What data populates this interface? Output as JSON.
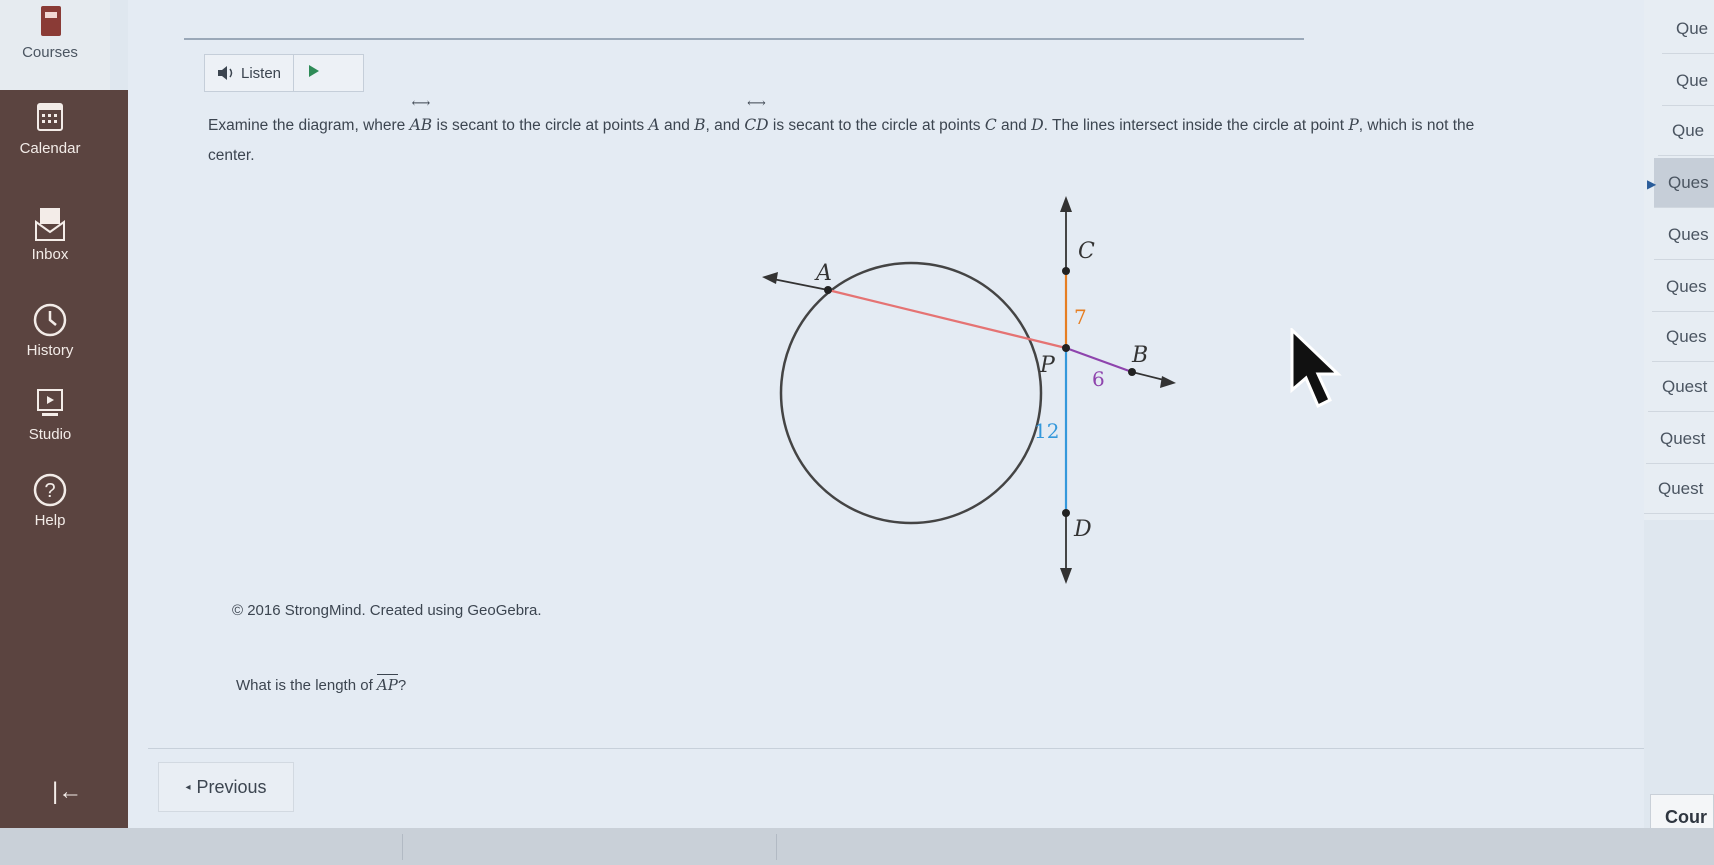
{
  "nav": {
    "items": [
      {
        "label": "Courses",
        "icon": "courses-icon"
      },
      {
        "label": "Calendar",
        "icon": "calendar-icon"
      },
      {
        "label": "Inbox",
        "icon": "inbox-icon"
      },
      {
        "label": "History",
        "icon": "history-icon"
      },
      {
        "label": "Studio",
        "icon": "studio-icon"
      },
      {
        "label": "Help",
        "icon": "help-icon"
      }
    ],
    "collapse_glyph": "|←"
  },
  "toolbar": {
    "listen_label": "Listen"
  },
  "question": {
    "p1": "Examine the diagram, where ",
    "ab": "AB",
    "p2": " is secant to the circle at points ",
    "a": "A",
    "p3": " and ",
    "b": "B",
    "p4": ", and ",
    "cd": "CD",
    "p5": " is secant to the circle at points ",
    "c": "C",
    "p6": " and ",
    "d": "D",
    "p7": ". The lines intersect inside the circle at point ",
    "p": "P",
    "p8": ", which is not the center.",
    "ask_prefix": "What is the length of ",
    "ask_seg": "AP",
    "ask_suffix": "?"
  },
  "diagram": {
    "points": {
      "A": "A",
      "B": "B",
      "C": "C",
      "D": "D",
      "P": "P"
    },
    "lengths": {
      "CP": "7",
      "PB": "6",
      "PD": "12"
    },
    "colors": {
      "AP": "#e57373",
      "PB": "#8e44ad",
      "CP": "#e67e22",
      "PD": "#3498db",
      "circle": "#444444"
    }
  },
  "credit": "© 2016 StrongMind. Created using GeoGebra.",
  "buttons": {
    "previous": "Previous"
  },
  "question_list": [
    "Que",
    "Que",
    "Que",
    "Ques",
    "Ques",
    "Ques",
    "Ques",
    "Quest",
    "Quest",
    "Quest"
  ],
  "active_question": 3,
  "course_button": "Cour"
}
